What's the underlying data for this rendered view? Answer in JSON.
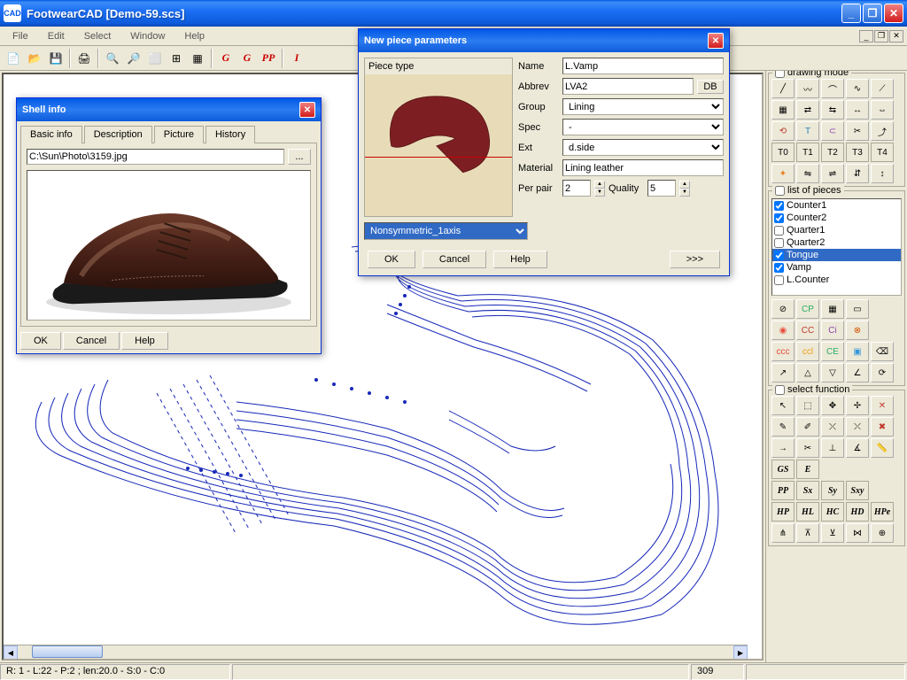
{
  "app": {
    "title": "FootwearCAD  [Demo-59.scs]",
    "logo": "CAD"
  },
  "menu": {
    "file": "File",
    "edit": "Edit",
    "select": "Select",
    "window": "Window",
    "help": "Help"
  },
  "toolbar": {
    "new": "□",
    "open": "📂",
    "save": "💾",
    "print": "🖨",
    "zoomin": "🔍+",
    "zoomout": "🔍-",
    "zoomwin": "□",
    "zoomfit": "⊞",
    "grading_g1": "G",
    "grading_g2": "G",
    "grading_pp": "PP",
    "info_i": "I"
  },
  "shell_info": {
    "title": "Shell info",
    "tabs": {
      "basic": "Basic info",
      "desc": "Description",
      "picture": "Picture",
      "history": "History"
    },
    "path": "C:\\Sun\\Photo\\3159.jpg",
    "browse": "...",
    "ok": "OK",
    "cancel": "Cancel",
    "help": "Help"
  },
  "new_piece": {
    "title": "New piece parameters",
    "piece_type_label": "Piece type",
    "symmetry_options": [
      "Nonsymmetric_1axis"
    ],
    "selected_symmetry": "Nonsymmetric_1axis",
    "name_label": "Name",
    "name": "L.Vamp",
    "abbrev_label": "Abbrev",
    "abbrev": "LVA2",
    "db_btn": "DB",
    "group_label": "Group",
    "group": "Lining",
    "spec_label": "Spec",
    "spec": "-",
    "ext_label": "Ext",
    "ext": "d.side",
    "material_label": "Material",
    "material": "Lining leather",
    "perpair_label": "Per pair",
    "perpair": "2",
    "quality_label": "Quality",
    "quality": "5",
    "ok": "OK",
    "cancel": "Cancel",
    "help": "Help",
    "more": ">>>"
  },
  "panels": {
    "drawing_mode": "drawing mode",
    "list_of_pieces": "list of pieces",
    "select_function": "select function",
    "pieces": [
      {
        "label": "Counter1",
        "checked": true,
        "sel": false
      },
      {
        "label": "Counter2",
        "checked": true,
        "sel": false
      },
      {
        "label": "Quarter1",
        "checked": false,
        "sel": false
      },
      {
        "label": "Quarter2",
        "checked": false,
        "sel": false
      },
      {
        "label": "Tongue",
        "checked": true,
        "sel": true
      },
      {
        "label": "Vamp",
        "checked": true,
        "sel": false
      },
      {
        "label": "L.Counter",
        "checked": false,
        "sel": false
      }
    ],
    "tbtns": {
      "t0": "T0",
      "t1": "T1",
      "t2": "T2",
      "t3": "T3",
      "t4": "T4"
    },
    "flabels": {
      "gs": "GS",
      "e": "E",
      "pp": "PP",
      "sx": "Sx",
      "sy": "Sy",
      "sxy": "Sxy",
      "hp": "HP",
      "hl": "HL",
      "hc": "HC",
      "hd": "HD",
      "hpe": "HPe"
    }
  },
  "status": {
    "left": "R: 1 - L:22 - P:2 ; len:20.0 - S:0 - C:0",
    "coord": "309"
  }
}
